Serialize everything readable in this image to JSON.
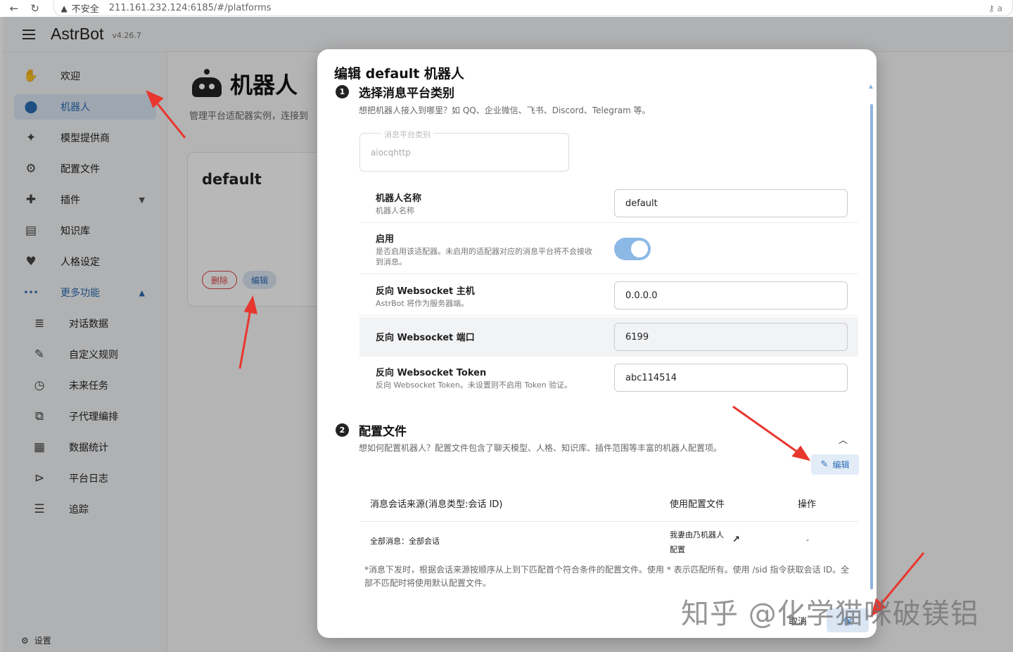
{
  "browser": {
    "warning": "不安全",
    "url": "211.161.232.124:6185/#/platforms",
    "right_text": "a"
  },
  "app": {
    "name": "AstrBot",
    "version": "v4.26.7"
  },
  "sidebar": {
    "items": [
      {
        "label": "欢迎",
        "icon": "hand-wave-icon",
        "glyph": "✋"
      },
      {
        "label": "机器人",
        "icon": "robot-icon",
        "glyph": "🤖"
      },
      {
        "label": "模型提供商",
        "icon": "sparkle-icon",
        "glyph": "✦"
      },
      {
        "label": "配置文件",
        "icon": "gear-icon",
        "glyph": "⚙"
      },
      {
        "label": "插件",
        "icon": "puzzle-icon",
        "glyph": "✚"
      },
      {
        "label": "知识库",
        "icon": "book-icon",
        "glyph": "📖"
      },
      {
        "label": "人格设定",
        "icon": "heart-icon",
        "glyph": "♥"
      },
      {
        "label": "更多功能",
        "icon": "more-dots-icon",
        "glyph": "•••"
      },
      {
        "label": "对话数据",
        "icon": "database-icon",
        "glyph": "🛢"
      },
      {
        "label": "自定义规则",
        "icon": "tools-icon",
        "glyph": "✎"
      },
      {
        "label": "未来任务",
        "icon": "clock-icon",
        "glyph": "◷"
      },
      {
        "label": "子代理编排",
        "icon": "layers-icon",
        "glyph": "⧉"
      },
      {
        "label": "数据统计",
        "icon": "dashboard-icon",
        "glyph": "▦"
      },
      {
        "label": "平台日志",
        "icon": "terminal-icon",
        "glyph": "⊳"
      },
      {
        "label": "追踪",
        "icon": "list-icon",
        "glyph": "☰"
      }
    ],
    "settings": "设置"
  },
  "page": {
    "title": "机器人",
    "subtitle": "管理平台适配器实例，连接到",
    "bot_card": {
      "name": "default",
      "delete_label": "删除",
      "edit_label": "编辑"
    }
  },
  "dialog": {
    "title": "编辑 default 机器人",
    "step1": {
      "num": "1",
      "title": "选择消息平台类别",
      "desc": "想把机器人接入到哪里？如 QQ、企业微信、飞书、Discord、Telegram 等。",
      "platform_legend": "消息平台类别",
      "platform_value": "aiocqhttp"
    },
    "fields": {
      "name": {
        "label": "机器人名称",
        "desc": "机器人名称",
        "value": "default"
      },
      "enable": {
        "label": "启用",
        "desc": "是否启用该适配器。未启用的适配器对应的消息平台将不会接收到消息。",
        "value": true
      },
      "ws_host": {
        "label": "反向 Websocket 主机",
        "desc": "AstrBot 将作为服务器端。",
        "value": "0.0.0.0"
      },
      "ws_port": {
        "label": "反向 Websocket 端口",
        "value": "6199"
      },
      "ws_token": {
        "label": "反向 Websocket Token",
        "desc": "反向 Websocket Token。未设置则不启用 Token 验证。",
        "value": "abc114514"
      }
    },
    "step2": {
      "num": "2",
      "title": "配置文件",
      "desc": "想如何配置机器人？配置文件包含了聊天模型、人格、知识库、插件范围等丰富的机器人配置项。",
      "edit_label": "编辑"
    },
    "table": {
      "headers": [
        "消息会话来源(消息类型:会话 ID)",
        "使用配置文件",
        "操作"
      ],
      "rows": [
        {
          "source": "全部消息：全部会话",
          "config": "我妻由乃机器人配置",
          "action": "-"
        }
      ]
    },
    "note": "*消息下发时，根据会话来源按顺序从上到下匹配首个符合条件的配置文件。使用 * 表示匹配所有。使用 /sid 指令获取会话 ID。全部不匹配时将使用默认配置文件。",
    "cancel_label": "取消",
    "save_label": "保"
  },
  "watermark": "知乎 @化学猫咪破镁铝",
  "colors": {
    "accent": "#2c6db5",
    "active_bg": "#dbe6f4",
    "annotation": "#e8372f",
    "toggle": "#8cb8e6"
  }
}
